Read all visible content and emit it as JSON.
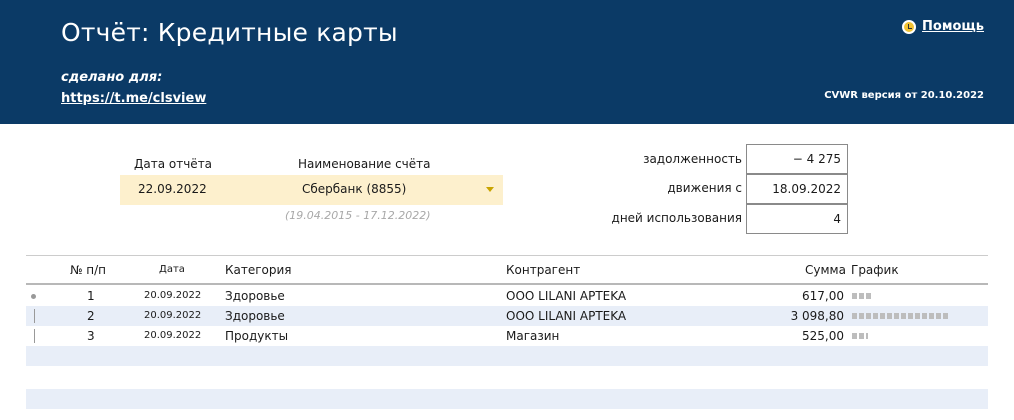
{
  "header": {
    "title": "Отчёт: Кредитные карты",
    "made_for": "сделано для:",
    "link": "https://t.me/clsview",
    "help": "Помощь",
    "version": "CVWR версия от 20.10.2022"
  },
  "filters": {
    "date_label": "Дата отчёта",
    "date_value": "22.09.2022",
    "account_label": "Наименование счёта",
    "account_value": "Сбербанк (8855)",
    "period": "(19.04.2015 - 17.12.2022)"
  },
  "stats": {
    "debt_label": "задолженность",
    "debt_value": "− 4 275",
    "movements_label": "движения с",
    "movements_value": "18.09.2022",
    "days_label": "дней использования",
    "days_value": "4"
  },
  "table": {
    "headers": {
      "num": "№ п/п",
      "date": "Дата",
      "category": "Категория",
      "counterparty": "Контрагент",
      "amount": "Сумма",
      "chart": "График"
    },
    "rows": [
      {
        "num": "1",
        "date": "20.09.2022",
        "category": "Здоровье",
        "counterparty": "ООО LILANI APTEKA",
        "amount": "617,00",
        "bar_fraction": 0.2
      },
      {
        "num": "2",
        "date": "20.09.2022",
        "category": "Здоровье",
        "counterparty": "ООО LILANI APTEKA",
        "amount": "3 098,80",
        "bar_fraction": 1.0
      },
      {
        "num": "3",
        "date": "20.09.2022",
        "category": "Продукты",
        "counterparty": "Магазин",
        "amount": "525,00",
        "bar_fraction": 0.17
      }
    ]
  },
  "colors": {
    "header_bg": "#0b3a66",
    "filter_bg": "#fdf0cd",
    "stripe_bg": "#e8eef8",
    "bar": "#bdbdbd"
  }
}
